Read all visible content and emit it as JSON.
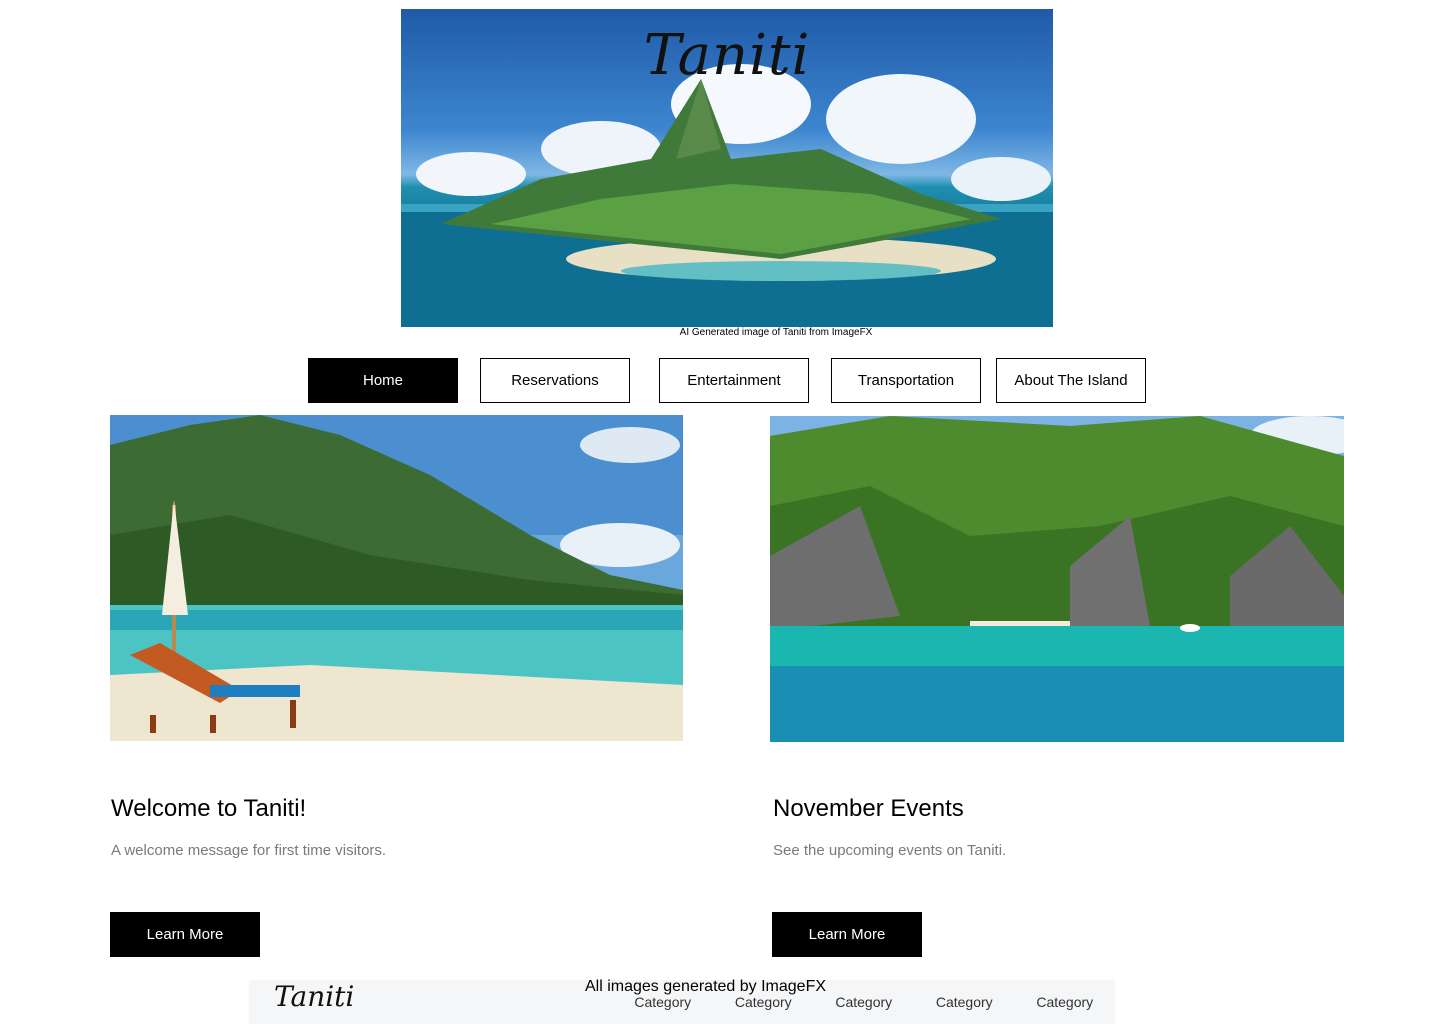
{
  "hero": {
    "logo_text": "Taniti",
    "caption": "AI Generated image of Taniti from ImageFX"
  },
  "nav": {
    "items": [
      {
        "label": "Home",
        "active": true
      },
      {
        "label": "Reservations",
        "active": false
      },
      {
        "label": "Entertainment",
        "active": false
      },
      {
        "label": "Transportation",
        "active": false
      },
      {
        "label": "About The Island",
        "active": false
      }
    ]
  },
  "cards": [
    {
      "title": "Welcome to Taniti!",
      "description": "A welcome message for first time visitors.",
      "button_label": "Learn More"
    },
    {
      "title": "November Events",
      "description": "See the upcoming events on Taniti.",
      "button_label": "Learn More"
    }
  ],
  "footer": {
    "logo_text": "Taniti",
    "credit": "All images generated by ImageFX",
    "categories": [
      "Category",
      "Category",
      "Category",
      "Category",
      "Category"
    ]
  },
  "colors": {
    "primary": "#000000",
    "muted_text": "#7a7a7a",
    "footer_bg": "#f5f6f8"
  }
}
